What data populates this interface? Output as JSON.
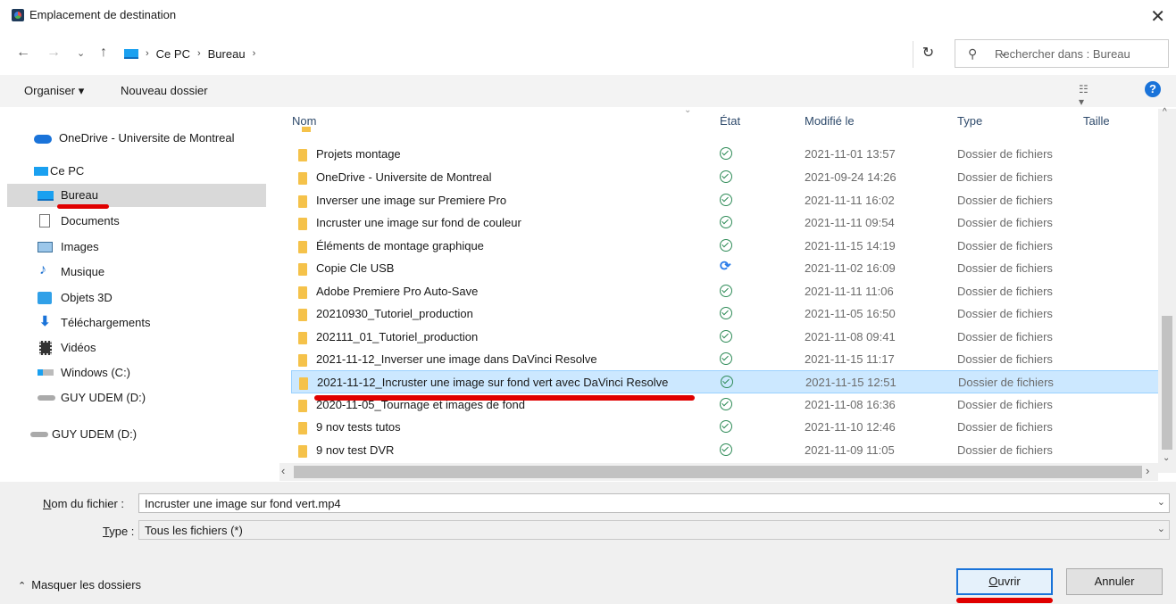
{
  "window": {
    "title": "Emplacement de destination",
    "close_icon": "close-icon"
  },
  "nav": {
    "breadcrumbs": [
      "Ce PC",
      "Bureau"
    ],
    "search_placeholder": "Rechercher dans : Bureau"
  },
  "toolbar": {
    "organize_label": "Organiser ▾",
    "new_folder_label": "Nouveau dossier",
    "help_label": "?"
  },
  "sidebar": {
    "items": [
      {
        "label": "OneDrive - Universite de Montreal",
        "icon": "cloud-icon"
      },
      {
        "label": "Ce PC",
        "icon": "computer-icon"
      },
      {
        "label": "Bureau",
        "icon": "desktop-icon",
        "selected": true
      },
      {
        "label": "Documents",
        "icon": "documents-icon"
      },
      {
        "label": "Images",
        "icon": "images-icon"
      },
      {
        "label": "Musique",
        "icon": "music-icon"
      },
      {
        "label": "Objets 3D",
        "icon": "cube-icon"
      },
      {
        "label": "Téléchargements",
        "icon": "download-icon"
      },
      {
        "label": "Vidéos",
        "icon": "video-icon"
      },
      {
        "label": "Windows (C:)",
        "icon": "drive-icon"
      },
      {
        "label": "GUY UDEM (D:)",
        "icon": "usb-drive-icon"
      },
      {
        "label": "GUY UDEM (D:)",
        "icon": "usb-drive-icon"
      }
    ]
  },
  "filelist": {
    "columns": {
      "name": "Nom",
      "status": "État",
      "modified": "Modifié le",
      "type": "Type",
      "size": "Taille"
    },
    "rows": [
      {
        "name": "Projets montage",
        "status": "synced",
        "modified": "2021-11-01 13:57",
        "type": "Dossier de fichiers"
      },
      {
        "name": "OneDrive - Universite de Montreal",
        "status": "synced",
        "modified": "2021-09-24 14:26",
        "type": "Dossier de fichiers"
      },
      {
        "name": "Inverser une image sur Premiere  Pro",
        "status": "synced",
        "modified": "2021-11-11 16:02",
        "type": "Dossier de fichiers"
      },
      {
        "name": "Incruster une image sur fond de couleur",
        "status": "synced",
        "modified": "2021-11-11 09:54",
        "type": "Dossier de fichiers"
      },
      {
        "name": "Éléments de montage graphique",
        "status": "synced",
        "modified": "2021-11-15 14:19",
        "type": "Dossier de fichiers"
      },
      {
        "name": "Copie Cle USB",
        "status": "syncing",
        "modified": "2021-11-02 16:09",
        "type": "Dossier de fichiers"
      },
      {
        "name": "Adobe Premiere Pro Auto-Save",
        "status": "synced",
        "modified": "2021-11-11 11:06",
        "type": "Dossier de fichiers"
      },
      {
        "name": "20210930_Tutoriel_production",
        "status": "synced",
        "modified": "2021-11-05 16:50",
        "type": "Dossier de fichiers"
      },
      {
        "name": "202111_01_Tutoriel_production",
        "status": "synced",
        "modified": "2021-11-08 09:41",
        "type": "Dossier de fichiers"
      },
      {
        "name": "2021-11-12_Inverser une image dans DaVinci Resolve",
        "status": "synced",
        "modified": "2021-11-15 11:17",
        "type": "Dossier de fichiers"
      },
      {
        "name": "2021-11-12_Incruster une image sur fond vert avec DaVinci Resolve",
        "status": "synced",
        "modified": "2021-11-15 12:51",
        "type": "Dossier de fichiers",
        "selected": true
      },
      {
        "name": "2020-11-05_Tournage et images de fond",
        "status": "synced",
        "modified": "2021-11-08 16:36",
        "type": "Dossier de fichiers"
      },
      {
        "name": "9 nov tests tutos",
        "status": "synced",
        "modified": "2021-11-10 12:46",
        "type": "Dossier de fichiers"
      },
      {
        "name": "9 nov test DVR",
        "status": "synced",
        "modified": "2021-11-09 11:05",
        "type": "Dossier de fichiers"
      }
    ]
  },
  "bottom": {
    "filename_label_u": "N",
    "filename_label_rest": "om du fichier :",
    "filename_value": "Incruster une image sur fond vert.mp4",
    "type_label_u": "T",
    "type_label_rest": "ype :",
    "type_value": "Tous les fichiers (*)",
    "hide_folders_label": "Masquer les dossiers",
    "open_label_u": "O",
    "open_label_rest": "uvrir",
    "cancel_label": "Annuler"
  },
  "annotation_color": "#e00000"
}
